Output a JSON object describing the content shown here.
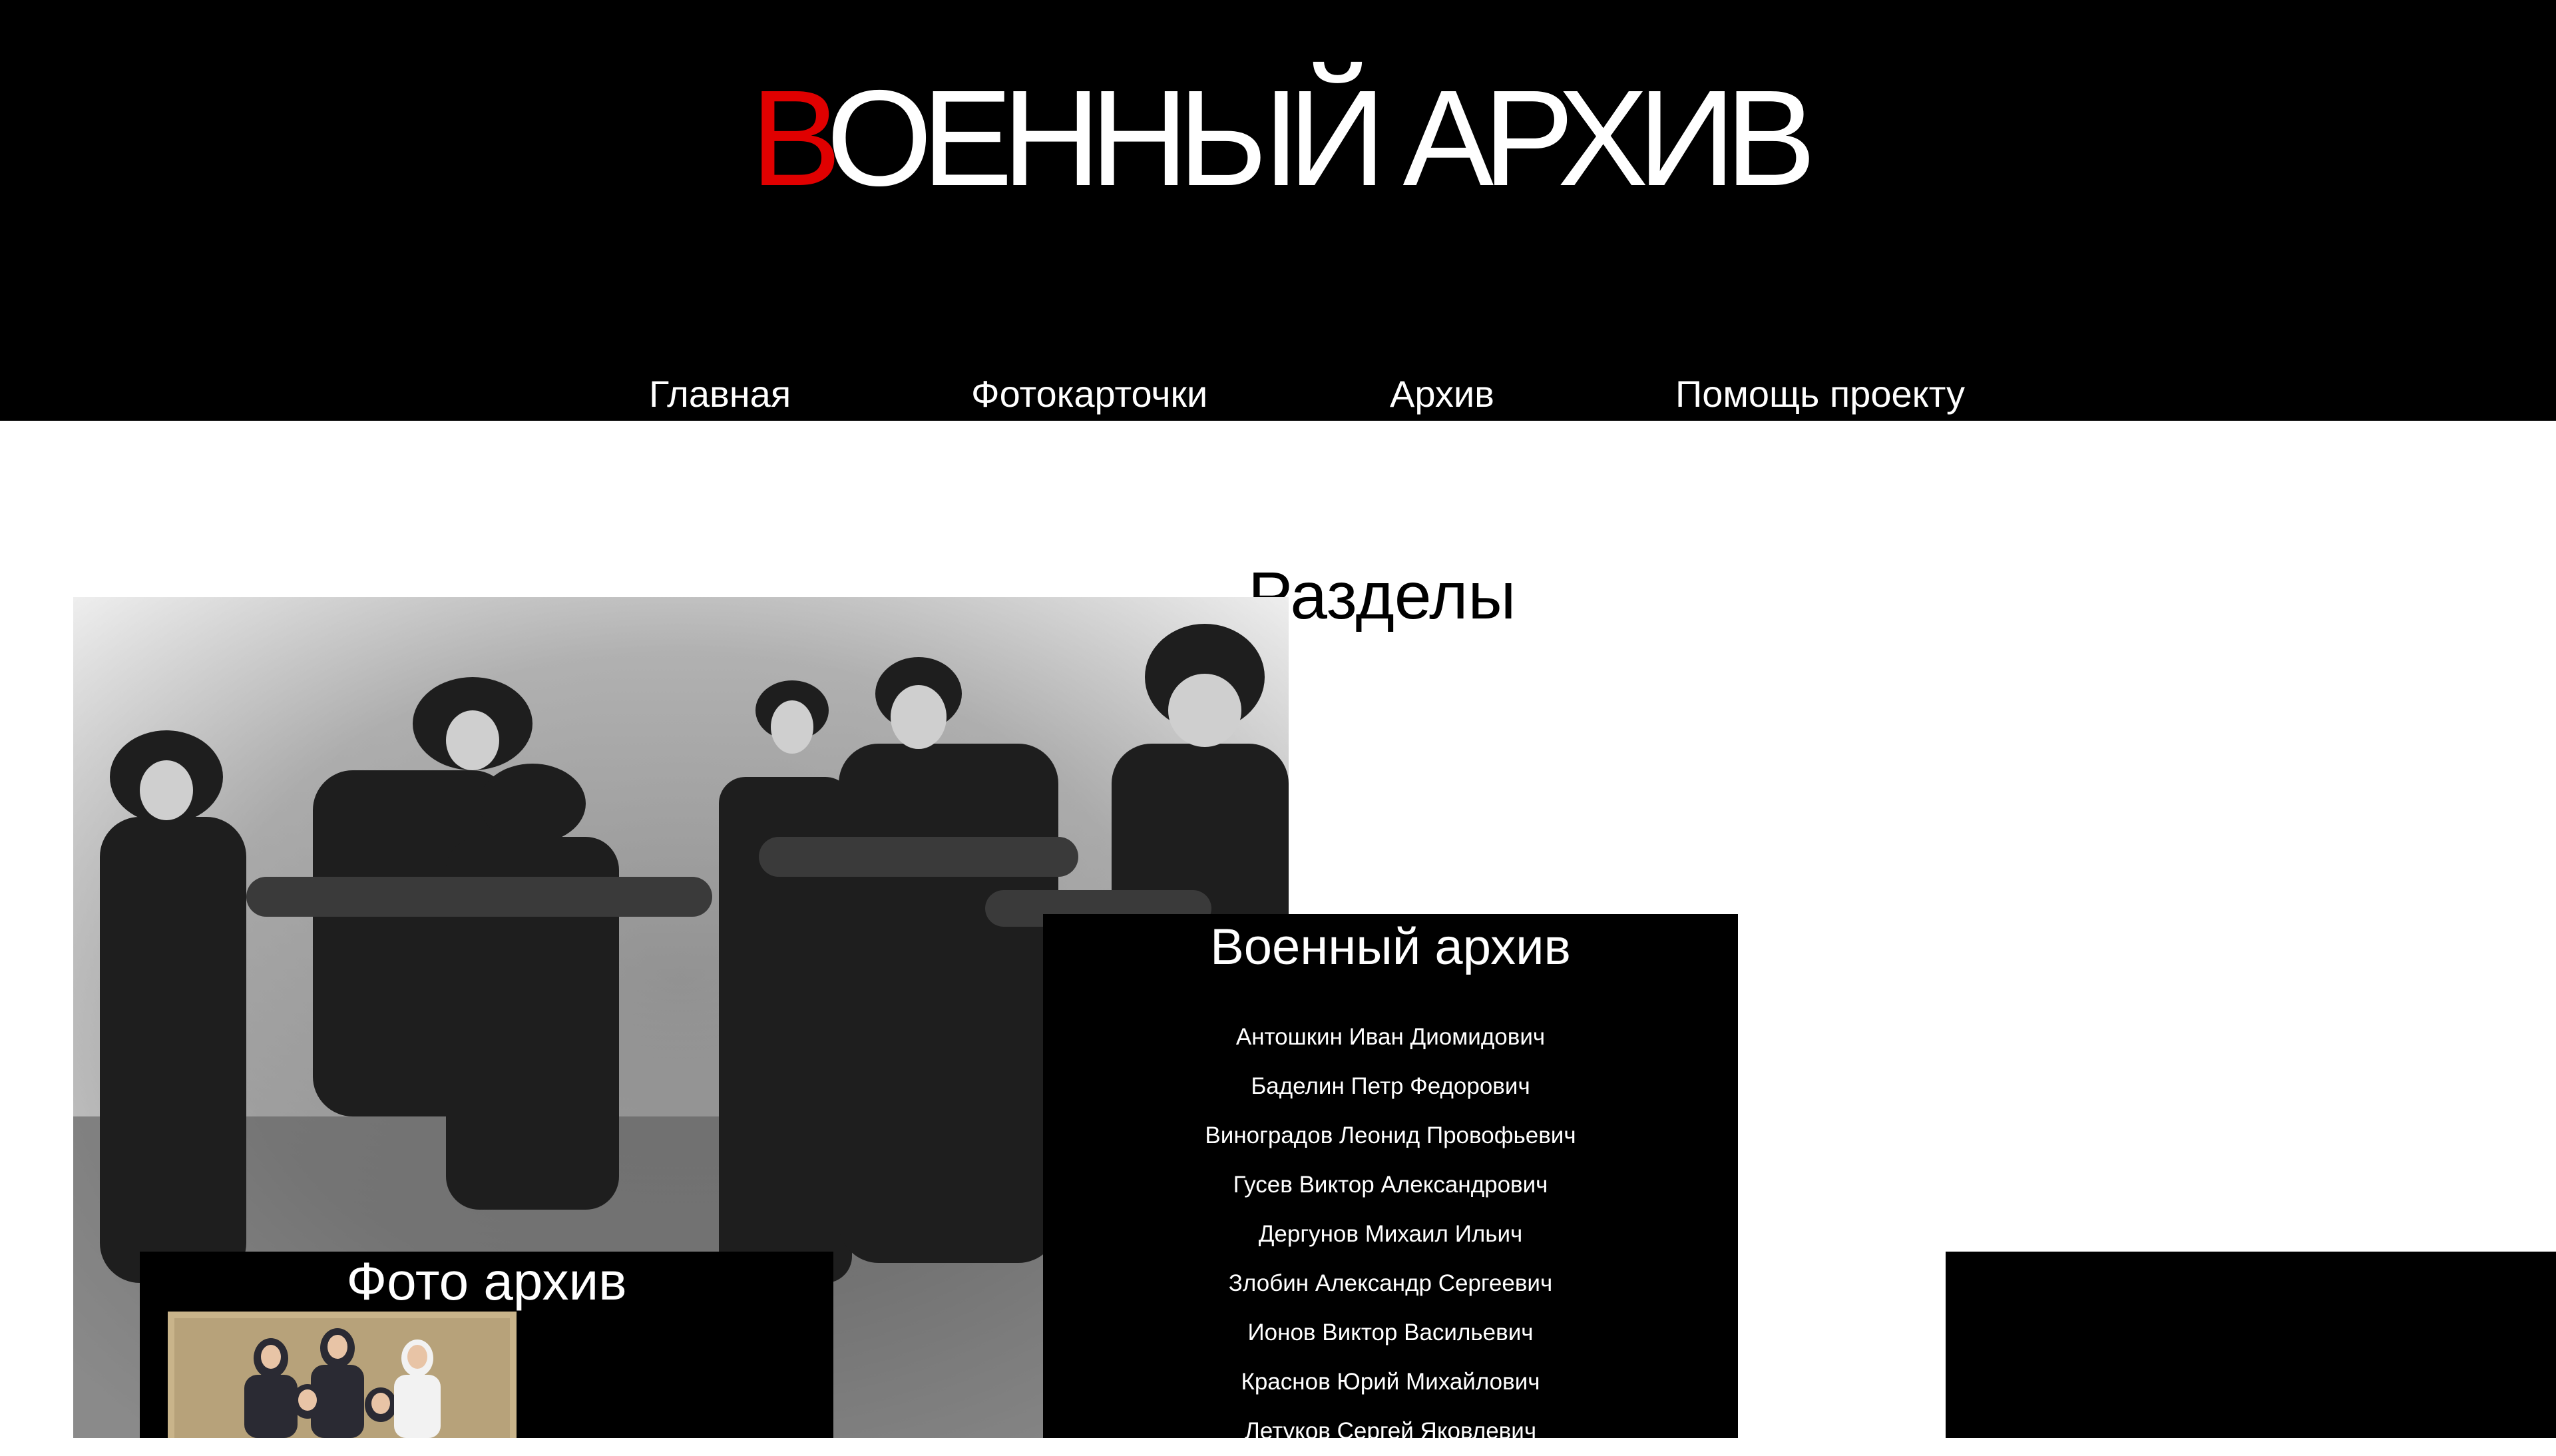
{
  "header": {
    "title_accent": "В",
    "title_rest": "ОЕННЫЙ АРХИВ",
    "accent_color": "#e00000",
    "background": "#000000"
  },
  "nav": {
    "items": [
      {
        "label": "Главная"
      },
      {
        "label": "Фотокарточки"
      },
      {
        "label": "Архив"
      },
      {
        "label": "Помощь проекту"
      }
    ]
  },
  "main": {
    "sections_title": "Разделы",
    "archive": {
      "title": "Военный архив",
      "people": [
        "Антошкин Иван Диомидович",
        "Баделин Петр Федорович",
        "Виноградов Леонид Провофьевич",
        "Гусев Виктор Александрович",
        "Дергунов Михаил Ильич",
        "Злобин Александр Сергеевич",
        "Ионов Виктор Васильевич",
        "Краснов Юрий Михайлович",
        "Летуков Сергей Яковлевич"
      ]
    },
    "photo_archive": {
      "title": "Фото архив"
    }
  }
}
